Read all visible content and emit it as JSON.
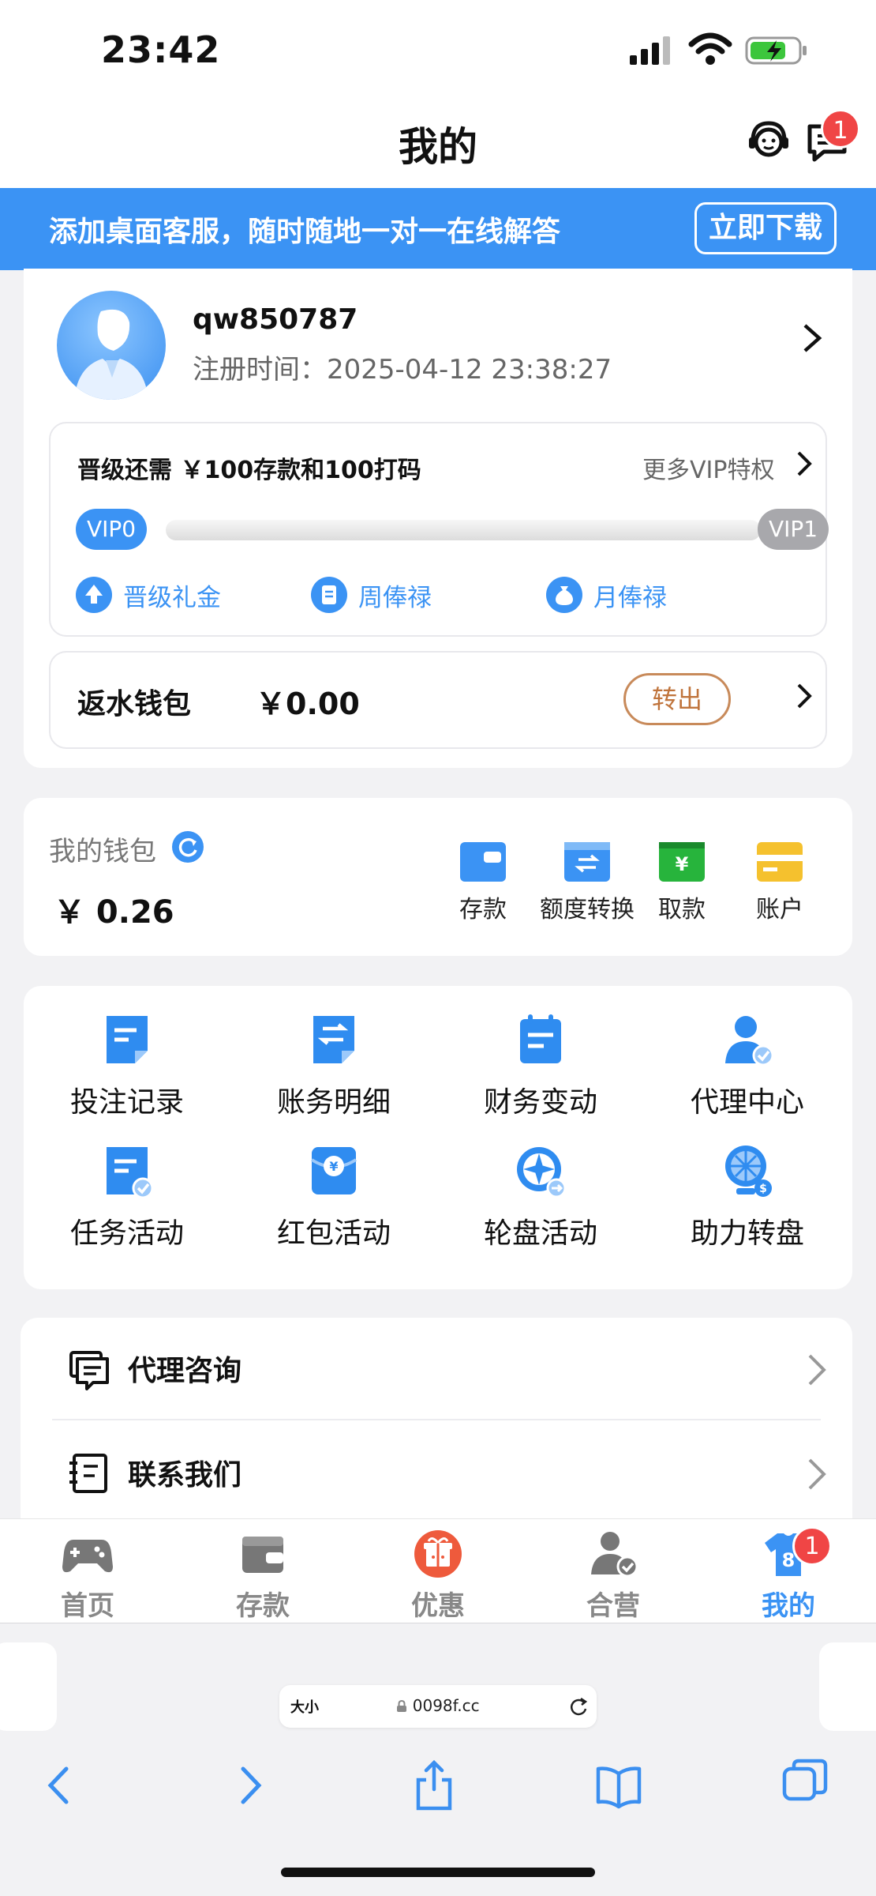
{
  "status_bar": {
    "time": "23:42"
  },
  "header": {
    "title": "我的",
    "message_badge": "1"
  },
  "banner": {
    "text": "添加桌面客服，随时随地一对一在线解答",
    "button": "立即下载"
  },
  "profile": {
    "username": "qw850787",
    "reg_label": "注册时间：",
    "reg_time": "2025-04-12 23:38:27",
    "vip": {
      "need_text": "晋级还需 ￥100存款和100打码",
      "more_text": "更多VIP特权",
      "current": "VIP0",
      "next": "VIP1",
      "progress": 0,
      "links": [
        {
          "label": "晋级礼金",
          "icon": "upgrade-gift-icon"
        },
        {
          "label": "周俸禄",
          "icon": "weekly-salary-icon"
        },
        {
          "label": "月俸禄",
          "icon": "monthly-salary-icon"
        }
      ]
    },
    "rebate": {
      "label": "返水钱包",
      "value": "￥0.00",
      "button": "转出"
    }
  },
  "wallet": {
    "title": "我的钱包",
    "value": "￥ 0.26",
    "actions": [
      {
        "label": "存款",
        "icon": "deposit-icon",
        "color": "#3b93f4"
      },
      {
        "label": "额度转换",
        "icon": "transfer-icon",
        "color": "#3b93f4"
      },
      {
        "label": "取款",
        "icon": "withdraw-icon",
        "color": "#27b43c"
      },
      {
        "label": "账户",
        "icon": "account-card-icon",
        "color": "#f5c12e"
      }
    ]
  },
  "grid": [
    {
      "label": "投注记录",
      "icon": "bet-record-icon"
    },
    {
      "label": "账务明细",
      "icon": "account-detail-icon"
    },
    {
      "label": "财务变动",
      "icon": "finance-change-icon"
    },
    {
      "label": "代理中心",
      "icon": "agent-center-icon"
    },
    {
      "label": "任务活动",
      "icon": "task-activity-icon"
    },
    {
      "label": "红包活动",
      "icon": "red-packet-icon"
    },
    {
      "label": "轮盘活动",
      "icon": "wheel-activity-icon"
    },
    {
      "label": "助力转盘",
      "icon": "boost-wheel-icon"
    }
  ],
  "list": [
    {
      "label": "代理咨询",
      "icon": "consult-icon"
    },
    {
      "label": "联系我们",
      "icon": "contact-icon"
    }
  ],
  "tabs": [
    {
      "label": "首页",
      "icon": "gamepad-icon"
    },
    {
      "label": "存款",
      "icon": "wallet-icon"
    },
    {
      "label": "优惠",
      "icon": "gift-icon"
    },
    {
      "label": "合营",
      "icon": "partner-icon"
    },
    {
      "label": "我的",
      "icon": "jersey-icon",
      "badge": "1"
    }
  ],
  "browser": {
    "text_size": "大小",
    "url": "0098f.cc"
  },
  "colors": {
    "accent": "#3b93f4",
    "badge": "#f04545",
    "transfer": "#c0743c"
  }
}
